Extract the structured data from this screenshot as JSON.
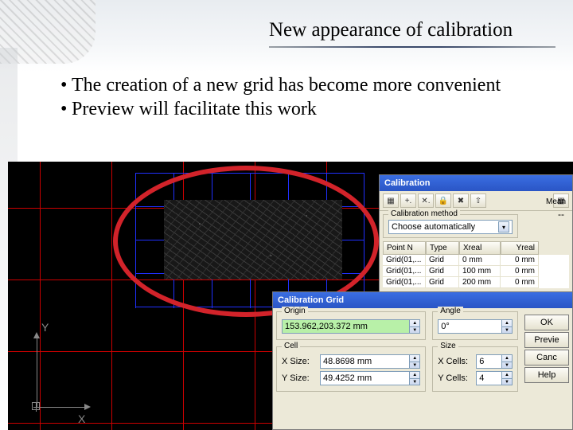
{
  "title": "New appearance of calibration",
  "bullets": [
    "The creation of a new grid has become more convenient",
    "Preview will facilitate this work"
  ],
  "axes": {
    "y": "Y",
    "x": "X"
  },
  "calibration_panel": {
    "title": "Calibration",
    "toolbar_icons": [
      "grid-icon",
      "add-point-icon",
      "delete-point-icon",
      "lock-icon",
      "clear-icon",
      "shift-icon",
      "grid2-icon"
    ],
    "icon_glyphs": [
      "▦",
      "+.",
      "✕.",
      "🔒",
      "✖",
      "⇧",
      "▦"
    ],
    "method_legend": "Calibration method",
    "method_value": "Choose automatically",
    "mean_label": "Mean",
    "mean_value": "--",
    "table": {
      "headers": [
        "Point N",
        "Type",
        "Xreal",
        "Yreal"
      ],
      "rows": [
        [
          "Grid(01,...",
          "Grid",
          "0 mm",
          "0 mm"
        ],
        [
          "Grid(01,...",
          "Grid",
          "100 mm",
          "0 mm"
        ],
        [
          "Grid(01,...",
          "Grid",
          "200 mm",
          "0 mm"
        ]
      ]
    }
  },
  "grid_dialog": {
    "title": "Calibration Grid",
    "origin_legend": "Origin",
    "origin_value": "153.962,203.372 mm",
    "angle_legend": "Angle",
    "angle_value": "0°",
    "cell_legend": "Cell",
    "xsize_label": "X Size:",
    "xsize_value": "48.8698 mm",
    "ysize_label": "Y Size:",
    "ysize_value": "49.4252 mm",
    "size_legend": "Size",
    "xcells_label": "X Cells:",
    "xcells_value": "6",
    "ycells_label": "Y Cells:",
    "ycells_value": "4",
    "buttons": {
      "ok": "OK",
      "preview": "Previe",
      "cancel": "Canc",
      "help": "Help"
    }
  }
}
